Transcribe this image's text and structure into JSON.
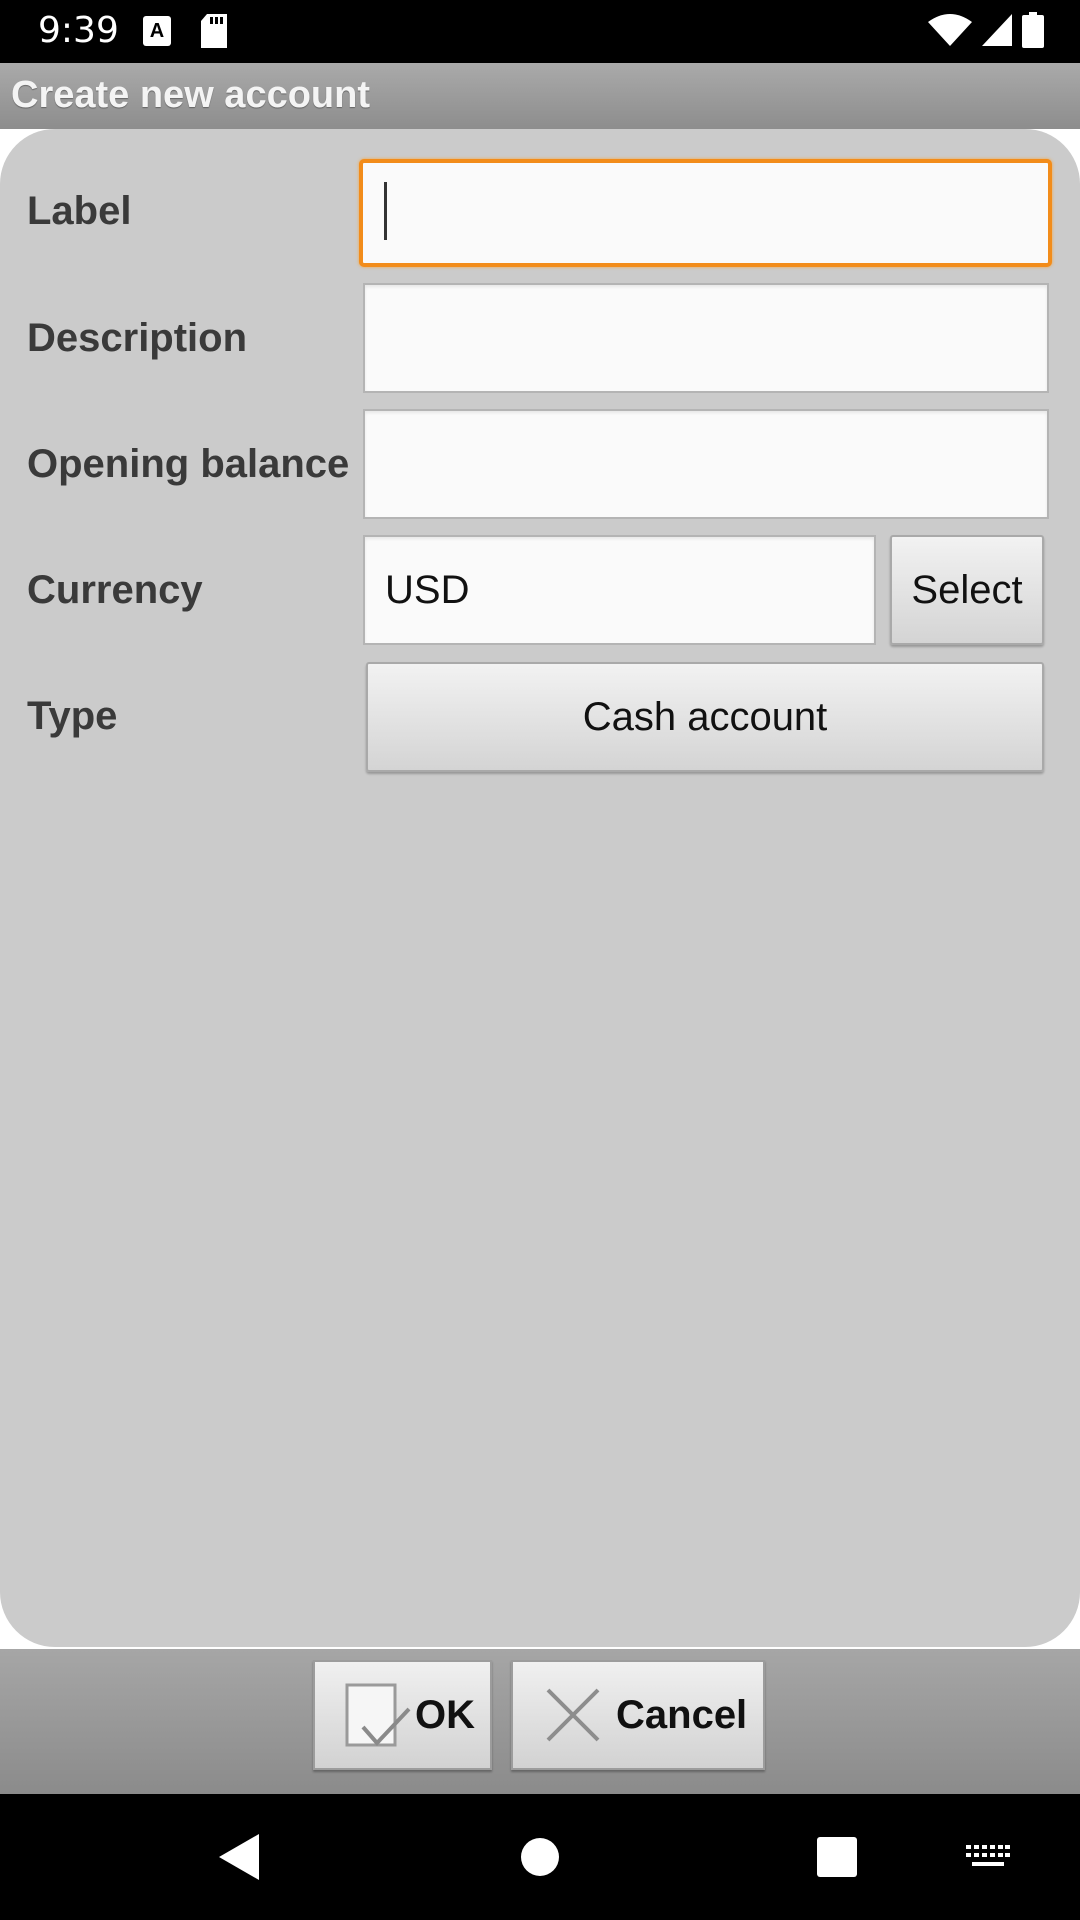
{
  "status_bar": {
    "time": "9:39",
    "icons": [
      "font-notification-icon",
      "sd-card-icon",
      "wifi-icon",
      "cell-signal-icon",
      "battery-icon"
    ]
  },
  "dialog": {
    "title": "Create new account",
    "fields": {
      "label": {
        "label": "Label",
        "value": ""
      },
      "description": {
        "label": "Description",
        "value": ""
      },
      "opening_balance": {
        "label": "Opening balance",
        "value": ""
      },
      "currency": {
        "label": "Currency",
        "value": "USD",
        "select_label": "Select"
      },
      "type": {
        "label": "Type",
        "value": "Cash account"
      }
    }
  },
  "actions": {
    "ok_label": "OK",
    "cancel_label": "Cancel"
  },
  "nav_bar": {
    "icons": [
      "back-icon",
      "home-icon",
      "recents-icon",
      "keyboard-icon"
    ]
  },
  "colors": {
    "focus_border": "#f28c1a",
    "content_bg": "#cbcbcb",
    "title_bar": "#9d9d9d"
  }
}
